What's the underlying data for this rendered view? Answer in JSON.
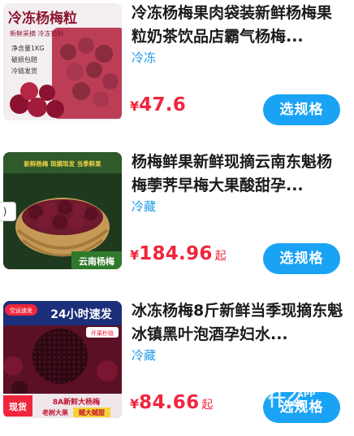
{
  "products": [
    {
      "title": "冷冻杨梅果肉袋装新鲜杨梅果粒奶茶饮品店霸气杨梅...",
      "tag": "冷冻",
      "currency": "¥",
      "price": "47.6",
      "price_suffix": "",
      "button": "选规格",
      "image": {
        "heading": "冷冻杨梅粒",
        "sub": "新鲜采摘 冷冻锁鲜",
        "bullets": [
          "净含量1KG",
          "破损包赔",
          "冷链发货"
        ]
      }
    },
    {
      "title": "杨梅鲜果新鲜现摘云南东魁杨梅荸荠早梅大果酸甜孕...",
      "tag": "冷藏",
      "currency": "¥",
      "price": "184.96",
      "price_suffix": "起",
      "button": "选规格",
      "image": {
        "banner": "新鲜杨梅 现摘现发 当季鲜果",
        "corner": "云南杨梅"
      }
    },
    {
      "title": "冰冻杨梅8斤新鲜当季现摘东魁冰镇黑叶泡酒孕妇水...",
      "tag": "冷藏",
      "currency": "¥",
      "price": "84.66",
      "price_suffix": "起",
      "button": "选规格",
      "image": {
        "badge": "空运速发",
        "headline": "24小时速发",
        "sub": "坏果秒赔",
        "stock": "现货",
        "line1": "8A新鲜大杨梅",
        "line2a": "老树大果",
        "line2b": "贼大贼甜"
      }
    }
  ],
  "edge_popup": ")",
  "watermark": {
    "big": "什么",
    "small": "APP"
  },
  "colors": {
    "price": "#f0263c",
    "button": "#1aa3f4",
    "tag": "#1f9be8",
    "title": "#1b1b1b"
  }
}
